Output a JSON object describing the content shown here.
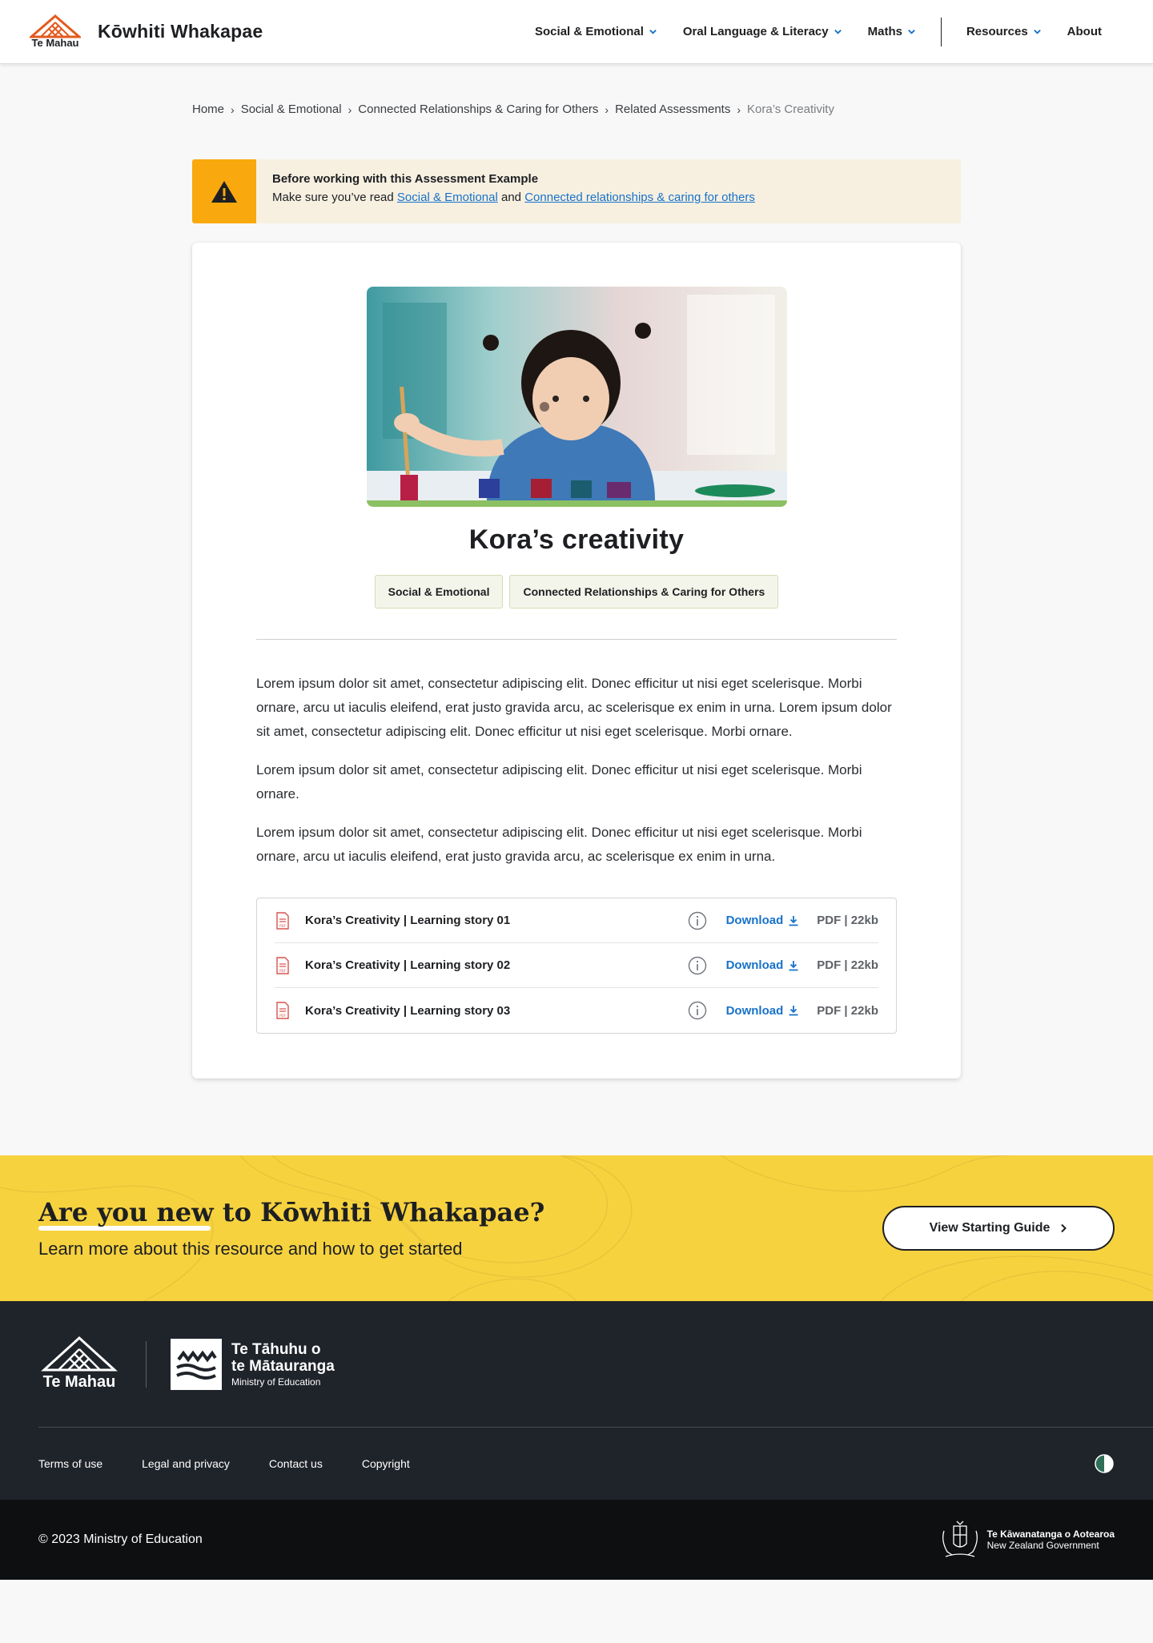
{
  "header": {
    "logo_text": "Te Mahau",
    "site_title": "Kōwhiti Whakapae",
    "nav": [
      {
        "label": "Social & Emotional"
      },
      {
        "label": "Oral Language & Literacy"
      },
      {
        "label": "Maths"
      },
      {
        "label": "Resources"
      },
      {
        "label": "About"
      }
    ]
  },
  "breadcrumb": [
    "Home",
    "Social & Emotional",
    "Connected Relationships & Caring for Others",
    "Related Assessments",
    "Kora’s Creativity"
  ],
  "notice": {
    "title": "Before working with this Assessment Example",
    "text_prefix": "Make sure you’ve read ",
    "link1": "Social & Emotional",
    "text_mid": " and ",
    "link2": "Connected relationships & caring for others"
  },
  "card": {
    "title": "Kora’s creativity",
    "tags": [
      "Social & Emotional",
      "Connected Relationships & Caring for Others"
    ],
    "paragraphs": [
      "Lorem ipsum dolor sit amet, consectetur adipiscing elit. Donec efficitur ut nisi eget scelerisque. Morbi ornare, arcu ut iaculis eleifend, erat justo gravida arcu, ac scelerisque ex enim in urna. Lorem ipsum dolor sit amet, consectetur adipiscing elit. Donec efficitur ut nisi eget scelerisque. Morbi ornare.",
      "Lorem ipsum dolor sit amet, consectetur adipiscing elit. Donec efficitur ut nisi eget scelerisque. Morbi ornare.",
      "Lorem ipsum dolor sit amet, consectetur adipiscing elit. Donec efficitur ut nisi eget scelerisque. Morbi ornare, arcu ut iaculis eleifend, erat justo gravida arcu, ac scelerisque ex enim in urna."
    ],
    "files": [
      {
        "name": "Kora’s Creativity | Learning story 01",
        "download": "Download",
        "meta": "PDF | 22kb"
      },
      {
        "name": "Kora’s Creativity | Learning story 02",
        "download": "Download",
        "meta": "PDF | 22kb"
      },
      {
        "name": "Kora’s Creativity | Learning story 03",
        "download": "Download",
        "meta": "PDF | 22kb"
      }
    ],
    "file_icon_label": "PDF"
  },
  "cta": {
    "heading": "Are you new to Kōwhiti Whakapae?",
    "subheading": "Learn more about this resource and how to get started",
    "button": "View Starting Guide"
  },
  "footer": {
    "temahau_text": "Te Mahau",
    "moe_line1": "Te Tāhuhu o",
    "moe_line2": "te Mātauranga",
    "moe_line3": "Ministry of Education",
    "links": [
      "Terms of use",
      "Legal and privacy",
      "Contact us",
      "Copyright"
    ],
    "copyright": "© 2023 Ministry of Education",
    "govt_line1": "Te Kāwanatanga o Aotearoa",
    "govt_line2": "New Zealand Government"
  },
  "colors": {
    "accent_blue": "#1872c9",
    "warning_orange": "#f9a90d",
    "cta_yellow": "#f6d23f",
    "footer_dark": "#1f232a",
    "image_bar_green": "#8cc063"
  }
}
